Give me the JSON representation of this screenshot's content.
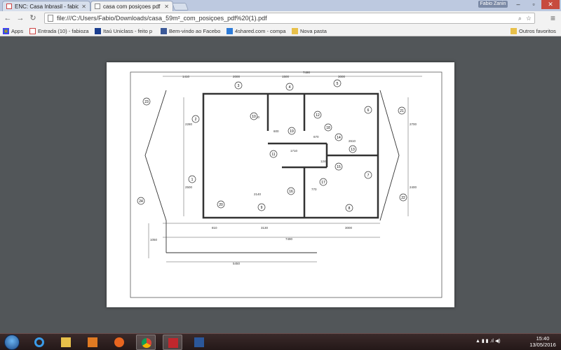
{
  "tabs": [
    {
      "title": "ENC: Casa Inbrasil - fabioz",
      "icon": "gmail-icon",
      "active": false
    },
    {
      "title": "casa com posiçoes pdf",
      "icon": "page-icon",
      "active": true
    }
  ],
  "user_name": "Fabio Zanin",
  "omnibox": {
    "url": "file:///C:/Users/Fabio/Downloads/casa_59m²_com_posiçoes_pdf%20(1).pdf"
  },
  "bookmarks": [
    {
      "label": "Apps",
      "icon": "apps-icon"
    },
    {
      "label": "Entrada (10) - fabioza",
      "icon": "gmail-icon"
    },
    {
      "label": "Itaú Uniclass - feito p",
      "icon": "itau-icon"
    },
    {
      "label": "Bem-vindo ao Facebo",
      "icon": "facebook-icon"
    },
    {
      "label": "4shared.com - compa",
      "icon": "4shared-icon"
    },
    {
      "label": "Nova pasta",
      "icon": "folder-icon"
    }
  ],
  "other_bookmarks": "Outros favoritos",
  "plan": {
    "dimensions": [
      "1410",
      "2000",
      "1500",
      "3000",
      "7490",
      "2280",
      "2500",
      "2140",
      "600",
      "1710",
      "670",
      "2610",
      "1240",
      "770",
      "3000",
      "810",
      "3130",
      "7490",
      "1050",
      "2700",
      "2400",
      "5450",
      "2140"
    ],
    "labels": [
      "1",
      "2",
      "3",
      "4",
      "5",
      "6",
      "7",
      "8",
      "9",
      "10",
      "11",
      "12",
      "13",
      "14",
      "15",
      "16",
      "17",
      "18",
      "19",
      "20",
      "21",
      "22",
      "23",
      "24"
    ]
  },
  "clock": {
    "time": "15:40",
    "date": "13/05/2016"
  }
}
